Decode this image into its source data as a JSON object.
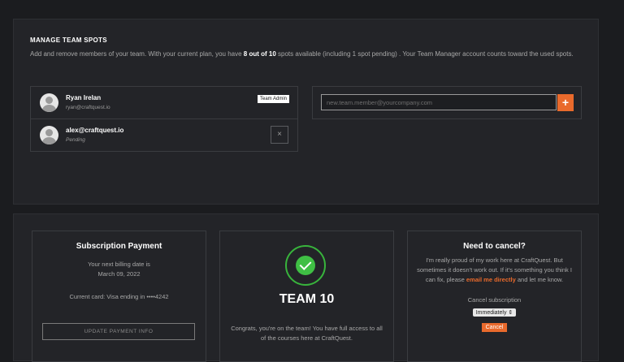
{
  "manage": {
    "title": "MANAGE TEAM SPOTS",
    "desc_pre": "Add and remove members of your team. With your current plan, you have ",
    "desc_bold": "8 out of 10",
    "desc_post": " spots available (including 1 spot pending) . Your Team Manager account counts toward the used spots.",
    "members": [
      {
        "name": "Ryan Irelan",
        "sub": "ryan@craftquest.io",
        "badge": "Team Admin"
      },
      {
        "name": "alex@craftquest.io",
        "sub": "Pending",
        "remove": "×"
      }
    ],
    "invite": {
      "placeholder": "new.team.member@yourcompany.com",
      "add": "+"
    }
  },
  "payment": {
    "title": "Subscription Payment",
    "billing_line1": "Your next billing date is",
    "billing_line2": "March 09, 2022",
    "card": "Current card: Visa ending in ••••4242",
    "button": "UPDATE PAYMENT INFO"
  },
  "team": {
    "name": "TEAM 10",
    "text": "Congrats, you're on the team! You have full access to all of the courses here at CraftQuest."
  },
  "cancel": {
    "title": "Need to cancel?",
    "text_pre": "I'm really proud of my work here at CraftQuest. But sometimes it doesn't work out. If it's something you think I can fix, please ",
    "link": "email me directly",
    "text_post": " and let me know.",
    "label": "Cancel subscription",
    "select_value": "Immediately",
    "select_caret": "⇕",
    "button": "Cancel"
  },
  "colors": {
    "accent": "#e96a2c",
    "success": "#3fbf44"
  }
}
